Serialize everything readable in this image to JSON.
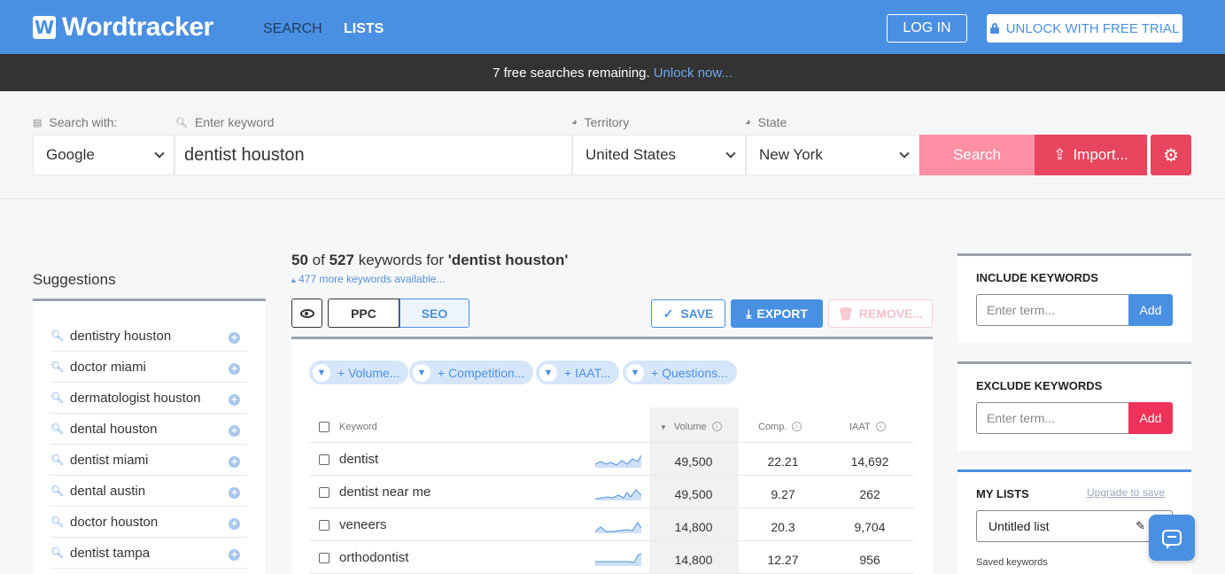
{
  "brand": {
    "logo_letter": "W",
    "name": "Wordtracker"
  },
  "nav": {
    "search": "SEARCH",
    "lists": "LISTS",
    "login": "LOG IN",
    "trial": "UNLOCK WITH FREE TRIAL"
  },
  "banner": {
    "text": "7 free searches remaining.",
    "link": "Unlock now..."
  },
  "search": {
    "engine_label": "Search with:",
    "engine_value": "Google",
    "keyword_label": "Enter keyword",
    "keyword_value": "dentist houston",
    "territory_label": "Territory",
    "territory_value": "United States",
    "state_label": "State",
    "state_value": "New York",
    "search_button": "Search",
    "import_button": "Import..."
  },
  "suggestions": {
    "title": "Suggestions",
    "items": [
      "dentistry houston",
      "doctor miami",
      "dermatologist houston",
      "dental houston",
      "dentist miami",
      "dental austin",
      "doctor houston",
      "dentist tampa"
    ]
  },
  "results": {
    "count_shown": "50",
    "of": "of",
    "count_total": "527",
    "label_mid": "keywords for",
    "query": "'dentist houston'",
    "more_count": "477",
    "more_text": "more keywords available...",
    "ppc": "PPC",
    "seo": "SEO",
    "save": "SAVE",
    "export": "EXPORT",
    "remove": "REMOVE...",
    "filters": [
      "+ Volume...",
      "+ Competition...",
      "+ IAAT...",
      "+ Questions..."
    ],
    "columns": {
      "keyword": "Keyword",
      "volume": "Volume",
      "comp": "Comp.",
      "iaat": "IAAT"
    },
    "rows": [
      {
        "keyword": "dentist",
        "volume": "49,500",
        "comp": "22.21",
        "iaat": "14,692"
      },
      {
        "keyword": "dentist near me",
        "volume": "49,500",
        "comp": "9.27",
        "iaat": "262"
      },
      {
        "keyword": "veneers",
        "volume": "14,800",
        "comp": "20.3",
        "iaat": "9,704"
      },
      {
        "keyword": "orthodontist",
        "volume": "14,800",
        "comp": "12.27",
        "iaat": "956"
      }
    ]
  },
  "include": {
    "title": "INCLUDE KEYWORDS",
    "placeholder": "Enter term...",
    "add": "Add"
  },
  "exclude": {
    "title": "EXCLUDE KEYWORDS",
    "placeholder": "Enter term...",
    "add": "Add"
  },
  "mylists": {
    "title": "MY LISTS",
    "upgrade": "Upgrade to save",
    "list_name": "Untitled list",
    "saved": "Saved keywords"
  },
  "colors": {
    "brand": "#4a90e2",
    "accent": "#e8455e",
    "search_button": "#ff8fa3",
    "banner": "#333333"
  },
  "icons": [
    "lock-icon",
    "eye-icon",
    "gear-icon",
    "search-icon",
    "filter-icon",
    "plus-circle-icon",
    "check-icon",
    "download-icon",
    "trash-icon",
    "pencil-icon",
    "chat-icon",
    "upload-icon",
    "globe-icon",
    "info-icon",
    "chevron-down-icon"
  ]
}
